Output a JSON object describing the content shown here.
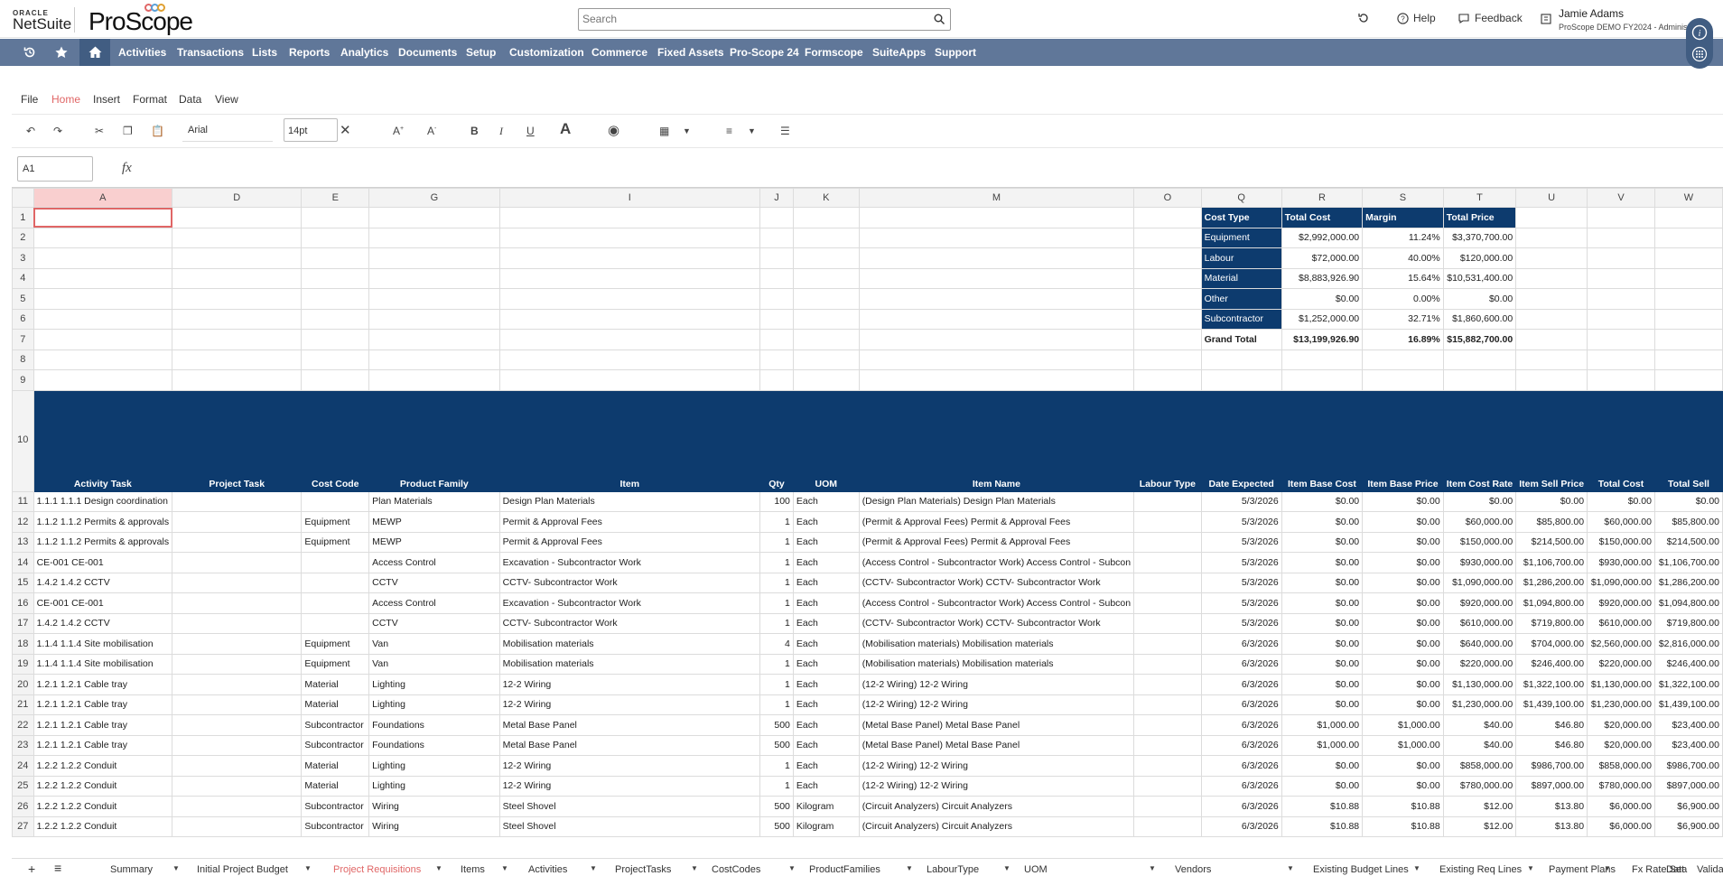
{
  "header": {
    "logo_oracle": "ORACLE",
    "logo_netsuite": "NetSuite",
    "logo_proscope": "ProScope",
    "search_placeholder": "Search",
    "help": "Help",
    "feedback": "Feedback",
    "user_name": "Jamie Adams",
    "user_role": "ProScope DEMO FY2024 - Administ"
  },
  "nav": {
    "items": [
      "Activities",
      "Transactions",
      "Lists",
      "Reports",
      "Analytics",
      "Documents",
      "Setup",
      "Customization",
      "Commerce",
      "Fixed Assets",
      "Pro-Scope 24",
      "Formscope",
      "SuiteApps",
      "Support"
    ]
  },
  "menu": {
    "items": [
      "File",
      "Home",
      "Insert",
      "Format",
      "Data",
      "View"
    ],
    "active": "Home"
  },
  "toolbar": {
    "font": "Arial",
    "size": "14pt",
    "name_box": "A1",
    "fx": "fx"
  },
  "columns": [
    "A",
    "D",
    "E",
    "G",
    "I",
    "J",
    "K",
    "M",
    "O",
    "Q",
    "R",
    "S",
    "T",
    "U",
    "V",
    "W"
  ],
  "summary": {
    "headers": [
      "Cost Type",
      "Total Cost",
      "Margin",
      "Total Price"
    ],
    "rows": [
      [
        "Equipment",
        "$2,992,000.00",
        "11.24%",
        "$3,370,700.00"
      ],
      [
        "Labour",
        "$72,000.00",
        "40.00%",
        "$120,000.00"
      ],
      [
        "Material",
        "$8,883,926.90",
        "15.64%",
        "$10,531,400.00"
      ],
      [
        "Other",
        "$0.00",
        "0.00%",
        "$0.00"
      ],
      [
        "Subcontractor",
        "$1,252,000.00",
        "32.71%",
        "$1,860,600.00"
      ]
    ],
    "total": [
      "Grand Total",
      "$13,199,926.90",
      "16.89%",
      "$15,882,700.00"
    ]
  },
  "table": {
    "headers": [
      "Activity Task",
      "Project Task",
      "Cost Code",
      "Product Family",
      "Item",
      "Qty",
      "UOM",
      "Item Name",
      "Labour Type",
      "Date Expected",
      "Item Base Cost",
      "Item Base Price",
      "Item Cost Rate",
      "Item Sell Price",
      "Total Cost",
      "Total Sell"
    ],
    "rows": [
      [
        "1.1.1 1.1.1 Design coordination",
        "",
        "",
        "Plan Materials",
        "Design Plan Materials",
        "100",
        "Each",
        "(Design Plan Materials) Design Plan Materials",
        "",
        "5/3/2026",
        "$0.00",
        "$0.00",
        "$0.00",
        "$0.00",
        "$0.00",
        "$0.00"
      ],
      [
        "1.1.2 1.1.2 Permits & approvals",
        "",
        "Equipment",
        "MEWP",
        "Permit & Approval Fees",
        "1",
        "Each",
        "(Permit & Approval Fees) Permit & Approval Fees",
        "",
        "5/3/2026",
        "$0.00",
        "$0.00",
        "$60,000.00",
        "$85,800.00",
        "$60,000.00",
        "$85,800.00"
      ],
      [
        "1.1.2 1.1.2 Permits & approvals",
        "",
        "Equipment",
        "MEWP",
        "Permit & Approval Fees",
        "1",
        "Each",
        "(Permit & Approval Fees) Permit & Approval Fees",
        "",
        "5/3/2026",
        "$0.00",
        "$0.00",
        "$150,000.00",
        "$214,500.00",
        "$150,000.00",
        "$214,500.00"
      ],
      [
        "CE-001 CE-001",
        "",
        "",
        "Access Control",
        "Excavation - Subcontractor Work",
        "1",
        "Each",
        "(Access Control - Subcontractor Work) Access Control - Subcon",
        "",
        "5/3/2026",
        "$0.00",
        "$0.00",
        "$930,000.00",
        "$1,106,700.00",
        "$930,000.00",
        "$1,106,700.00"
      ],
      [
        "1.4.2 1.4.2 CCTV",
        "",
        "",
        "CCTV",
        "CCTV- Subcontractor Work",
        "1",
        "Each",
        "(CCTV- Subcontractor Work) CCTV- Subcontractor Work",
        "",
        "5/3/2026",
        "$0.00",
        "$0.00",
        "$1,090,000.00",
        "$1,286,200.00",
        "$1,090,000.00",
        "$1,286,200.00"
      ],
      [
        "CE-001 CE-001",
        "",
        "",
        "Access Control",
        "Excavation - Subcontractor Work",
        "1",
        "Each",
        "(Access Control - Subcontractor Work) Access Control - Subcon",
        "",
        "5/3/2026",
        "$0.00",
        "$0.00",
        "$920,000.00",
        "$1,094,800.00",
        "$920,000.00",
        "$1,094,800.00"
      ],
      [
        "1.4.2 1.4.2 CCTV",
        "",
        "",
        "CCTV",
        "CCTV- Subcontractor Work",
        "1",
        "Each",
        "(CCTV- Subcontractor Work) CCTV- Subcontractor Work",
        "",
        "5/3/2026",
        "$0.00",
        "$0.00",
        "$610,000.00",
        "$719,800.00",
        "$610,000.00",
        "$719,800.00"
      ],
      [
        "1.1.4 1.1.4 Site mobilisation",
        "",
        "Equipment",
        "Van",
        "Mobilisation materials",
        "4",
        "Each",
        "(Mobilisation materials) Mobilisation materials",
        "",
        "6/3/2026",
        "$0.00",
        "$0.00",
        "$640,000.00",
        "$704,000.00",
        "$2,560,000.00",
        "$2,816,000.00"
      ],
      [
        "1.1.4 1.1.4 Site mobilisation",
        "",
        "Equipment",
        "Van",
        "Mobilisation materials",
        "1",
        "Each",
        "(Mobilisation materials) Mobilisation materials",
        "",
        "6/3/2026",
        "$0.00",
        "$0.00",
        "$220,000.00",
        "$246,400.00",
        "$220,000.00",
        "$246,400.00"
      ],
      [
        "1.2.1 1.2.1 Cable tray",
        "",
        "Material",
        "Lighting",
        "12-2 Wiring",
        "1",
        "Each",
        "(12-2 Wiring) 12-2 Wiring",
        "",
        "6/3/2026",
        "$0.00",
        "$0.00",
        "$1,130,000.00",
        "$1,322,100.00",
        "$1,130,000.00",
        "$1,322,100.00"
      ],
      [
        "1.2.1 1.2.1 Cable tray",
        "",
        "Material",
        "Lighting",
        "12-2 Wiring",
        "1",
        "Each",
        "(12-2 Wiring) 12-2 Wiring",
        "",
        "6/3/2026",
        "$0.00",
        "$0.00",
        "$1,230,000.00",
        "$1,439,100.00",
        "$1,230,000.00",
        "$1,439,100.00"
      ],
      [
        "1.2.1 1.2.1 Cable tray",
        "",
        "Subcontractor",
        "Foundations",
        "Metal Base Panel",
        "500",
        "Each",
        "(Metal Base Panel) Metal Base Panel",
        "",
        "6/3/2026",
        "$1,000.00",
        "$1,000.00",
        "$40.00",
        "$46.80",
        "$20,000.00",
        "$23,400.00"
      ],
      [
        "1.2.1 1.2.1 Cable tray",
        "",
        "Subcontractor",
        "Foundations",
        "Metal Base Panel",
        "500",
        "Each",
        "(Metal Base Panel) Metal Base Panel",
        "",
        "6/3/2026",
        "$1,000.00",
        "$1,000.00",
        "$40.00",
        "$46.80",
        "$20,000.00",
        "$23,400.00"
      ],
      [
        "1.2.2 1.2.2 Conduit",
        "",
        "Material",
        "Lighting",
        "12-2 Wiring",
        "1",
        "Each",
        "(12-2 Wiring) 12-2 Wiring",
        "",
        "6/3/2026",
        "$0.00",
        "$0.00",
        "$858,000.00",
        "$986,700.00",
        "$858,000.00",
        "$986,700.00"
      ],
      [
        "1.2.2 1.2.2 Conduit",
        "",
        "Material",
        "Lighting",
        "12-2 Wiring",
        "1",
        "Each",
        "(12-2 Wiring) 12-2 Wiring",
        "",
        "6/3/2026",
        "$0.00",
        "$0.00",
        "$780,000.00",
        "$897,000.00",
        "$780,000.00",
        "$897,000.00"
      ],
      [
        "1.2.2 1.2.2 Conduit",
        "",
        "Subcontractor",
        "Wiring",
        "Steel Shovel",
        "500",
        "Kilogram",
        "(Circuit Analyzers) Circuit Analyzers",
        "",
        "6/3/2026",
        "$10.88",
        "$10.88",
        "$12.00",
        "$13.80",
        "$6,000.00",
        "$6,900.00"
      ],
      [
        "1.2.2 1.2.2 Conduit",
        "",
        "Subcontractor",
        "Wiring",
        "Steel Shovel",
        "500",
        "Kilogram",
        "(Circuit Analyzers) Circuit Analyzers",
        "",
        "6/3/2026",
        "$10.88",
        "$10.88",
        "$12.00",
        "$13.80",
        "$6,000.00",
        "$6,900.00"
      ]
    ]
  },
  "sheet_tabs": [
    "Summary",
    "Initial Project Budget",
    "Project Requisitions",
    "Items",
    "Activities",
    "ProjectTasks",
    "CostCodes",
    "ProductFamilies",
    "LabourType",
    "UOM",
    "Vendors",
    "Existing Budget Lines",
    "Existing Req Lines",
    "Payment Plans",
    "Fx Rate Set",
    "Data",
    "Validation"
  ],
  "active_sheet": "Project Requisitions",
  "colors": {
    "nav": "#607799",
    "header_blue": "#0d3b6e",
    "active": "#e06666"
  }
}
